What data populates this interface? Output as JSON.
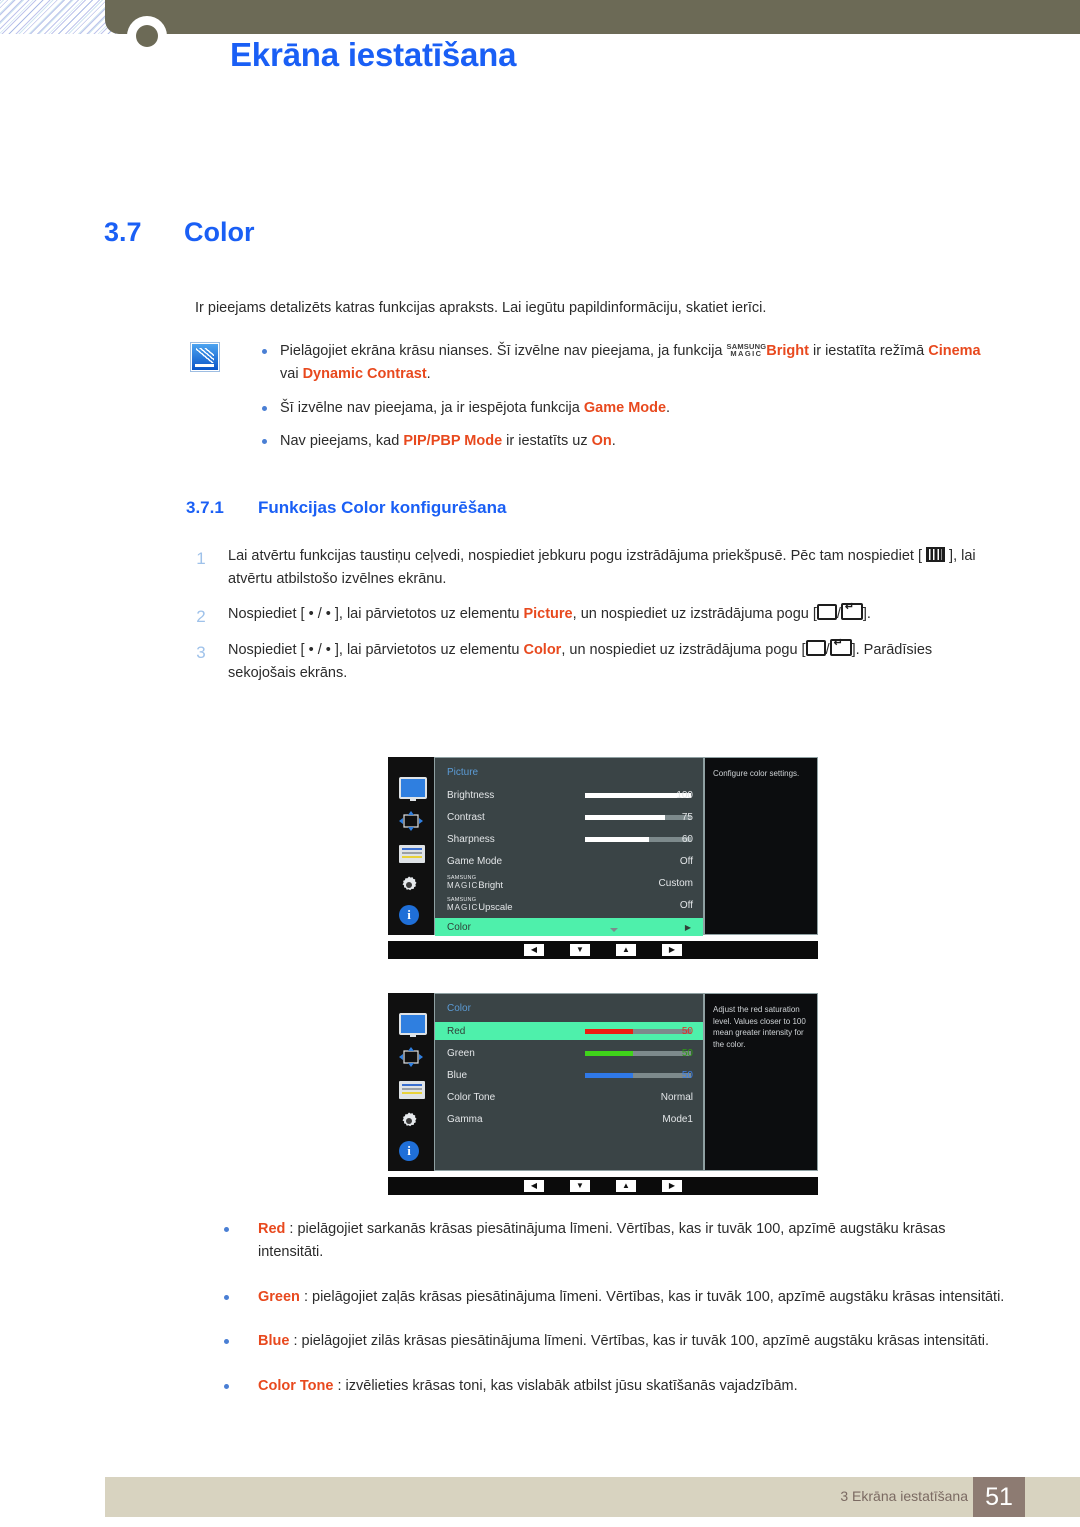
{
  "header": {
    "title": "Ekrāna iestatīšana",
    "circle_icon": "chapter-circle-icon"
  },
  "section": {
    "number": "3.7",
    "title": "Color",
    "intro": "Ir pieejams detalizēts katras funkcijas apraksts. Lai iegūtu papildinformāciju, skatiet ierīci."
  },
  "notes": {
    "icon": "note-pencil-icon",
    "items": [
      {
        "pre": "Pielāgojiet ekrāna krāsu nianses. Šī izvēlne nav pieejama, ja funkcija ",
        "magic_top": "SAMSUNG",
        "magic_bottom": "MAGIC",
        "magic_word": "Bright",
        "mid": " ir iestatīta režīmā ",
        "hl1": "Cinema",
        "conj": " vai ",
        "hl2": "Dynamic Contrast",
        "post": "."
      },
      {
        "pre": "Šī izvēlne nav pieejama, ja ir iespējota funkcija ",
        "hl1": "Game Mode",
        "post": "."
      },
      {
        "pre": "Nav pieejams, kad ",
        "hl1": "PIP/PBP Mode",
        "mid": " ir iestatīts uz ",
        "hl2": "On",
        "post": "."
      }
    ]
  },
  "subsection": {
    "number": "3.7.1",
    "title": "Funkcijas Color konfigurēšana"
  },
  "steps": [
    {
      "num": "1",
      "a": "Lai atvērtu funkcijas taustiņu ceļvedi, nospiediet jebkuru pogu izstrādājuma priekšpusē. Pēc tam nospiediet [ ",
      "b": " ], lai atvērtu atbilstošo izvēlnes ekrānu."
    },
    {
      "num": "2",
      "a": "Nospiediet [ • / • ], lai pārvietotos uz elementu ",
      "hl": "Picture",
      "b": ", un nospiediet uz izstrādājuma pogu [",
      "c": "/",
      "d": "]."
    },
    {
      "num": "3",
      "a": "Nospiediet [ • / • ], lai pārvietotos uz elementu ",
      "hl": "Color",
      "b": ", un nospiediet uz izstrādājuma pogu [",
      "c": "/",
      "d": "]. Parādīsies sekojošais ekrāns."
    }
  ],
  "osd_picture": {
    "title": "Picture",
    "help": "Configure color settings.",
    "rows": [
      {
        "label": "Brightness",
        "value": "100",
        "slider": 100
      },
      {
        "label": "Contrast",
        "value": "75",
        "slider": 75
      },
      {
        "label": "Sharpness",
        "value": "60",
        "slider": 60
      },
      {
        "label": "Game Mode",
        "value": "Off"
      },
      {
        "label": "MAGICBright",
        "magic_top": "SAMSUNG",
        "magic_mid": "MAGIC",
        "magic_word": "Bright",
        "value": "Custom"
      },
      {
        "label": "MAGICUpscale",
        "magic_top": "SAMSUNG",
        "magic_mid": "MAGIC",
        "magic_word": "Upscale",
        "value": "Off"
      },
      {
        "label": "Color",
        "value": "",
        "selected": true,
        "arrow": "▶"
      }
    ],
    "sidebar_icons": [
      "monitor-icon",
      "move-icon",
      "list-icon",
      "gear-icon",
      "info-icon"
    ],
    "nav": [
      "◀",
      "▼",
      "▲",
      "▶"
    ]
  },
  "osd_color": {
    "title": "Color",
    "help": "Adjust the red saturation level. Values closer to 100 mean greater intensity for the color.",
    "rows": [
      {
        "label": "Red",
        "value": "50",
        "slider": 45,
        "color": "#ee1c10",
        "valcolor": "#e03020",
        "selected": true
      },
      {
        "label": "Green",
        "value": "50",
        "slider": 45,
        "color": "#3fd41a",
        "valcolor": "#2f9d16"
      },
      {
        "label": "Blue",
        "value": "50",
        "slider": 45,
        "color": "#2f79e8",
        "valcolor": "#3a7fe8"
      },
      {
        "label": "Color Tone",
        "value": "Normal"
      },
      {
        "label": "Gamma",
        "value": "Mode1"
      }
    ],
    "sidebar_icons": [
      "monitor-icon",
      "move-icon",
      "list-icon",
      "gear-icon",
      "info-icon"
    ],
    "nav": [
      "◀",
      "▼",
      "▲",
      "▶"
    ]
  },
  "lower_bullets": [
    {
      "hl": "Red",
      "text": " : pielāgojiet sarkanās krāsas piesātinājuma līmeni. Vērtības, kas ir tuvāk 100, apzīmē augstāku krāsas intensitāti."
    },
    {
      "hl": "Green",
      "text": " : pielāgojiet zaļās krāsas piesātinājuma līmeni. Vērtības, kas ir tuvāk 100, apzīmē augstāku krāsas intensitāti."
    },
    {
      "hl": "Blue",
      "text": " : pielāgojiet zilās krāsas piesātinājuma līmeni. Vērtības, kas ir tuvāk 100, apzīmē augstāku krāsas intensitāti."
    },
    {
      "hl": "Color Tone",
      "text": " : izvēlieties krāsas toni, kas vislabāk atbilst jūsu skatīšanās vajadzībām."
    }
  ],
  "footer": {
    "text": "3 Ekrāna iestatīšana",
    "page": "51"
  },
  "colors": {
    "accent_blue": "#1a5ff5",
    "highlight_orange": "#e8491e",
    "header_olive": "#6c6a56",
    "footer_beige": "#d8d3c0",
    "page_brown": "#8d7b72",
    "osd_select_green": "#4ef0ab"
  }
}
